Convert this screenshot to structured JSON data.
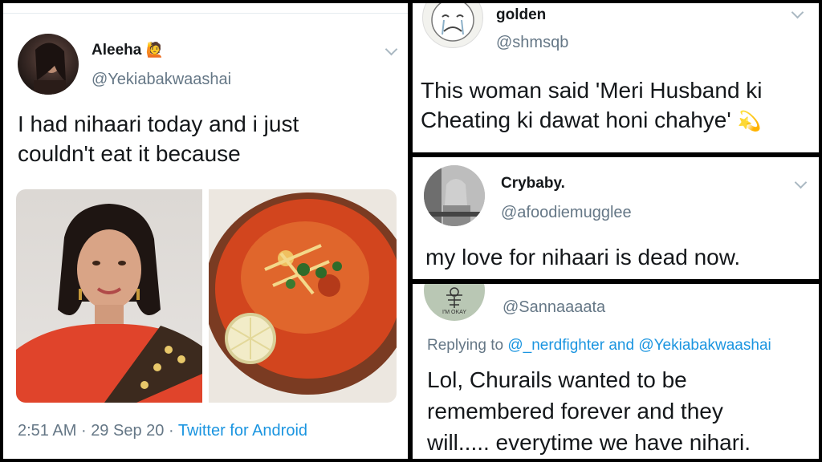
{
  "main_tweet": {
    "name": "Aleeha",
    "emoji": "🙋",
    "handle": "@Yekiabakwaashai",
    "text_line1": "I had nihaari today and i just",
    "text_line2": "couldn't eat it because",
    "time": "2:51 AM",
    "separator": "·",
    "date": "29 Sep 20",
    "source": "Twitter for Android"
  },
  "golden_tweet": {
    "name": "golden",
    "handle": "@shmsqb",
    "text_line1": "This woman said 'Meri Husband ki",
    "text_line2": "Cheating ki dawat honi chahye'",
    "emoji": "💫"
  },
  "crybaby_tweet": {
    "name": "Crybaby.",
    "handle": "@afoodiemugglee",
    "text": "my love for nihaari is dead now."
  },
  "sanna_tweet": {
    "handle": "@Sannaaaata",
    "avatar_text": "I'M OKAY",
    "replying_prefix": "Replying to",
    "reply_user1": "@_nerdfighter",
    "reply_and": "and",
    "reply_user2": "@Yekiabakwaashai",
    "text_line1": "Lol,  Churails wanted to be",
    "text_line2": "remembered forever and they",
    "text_line3": "will..... everytime we have nihari."
  },
  "colors": {
    "link": "#1b95e0",
    "secondary_text": "#657786",
    "primary_text": "#14171a",
    "border": "#000000"
  }
}
